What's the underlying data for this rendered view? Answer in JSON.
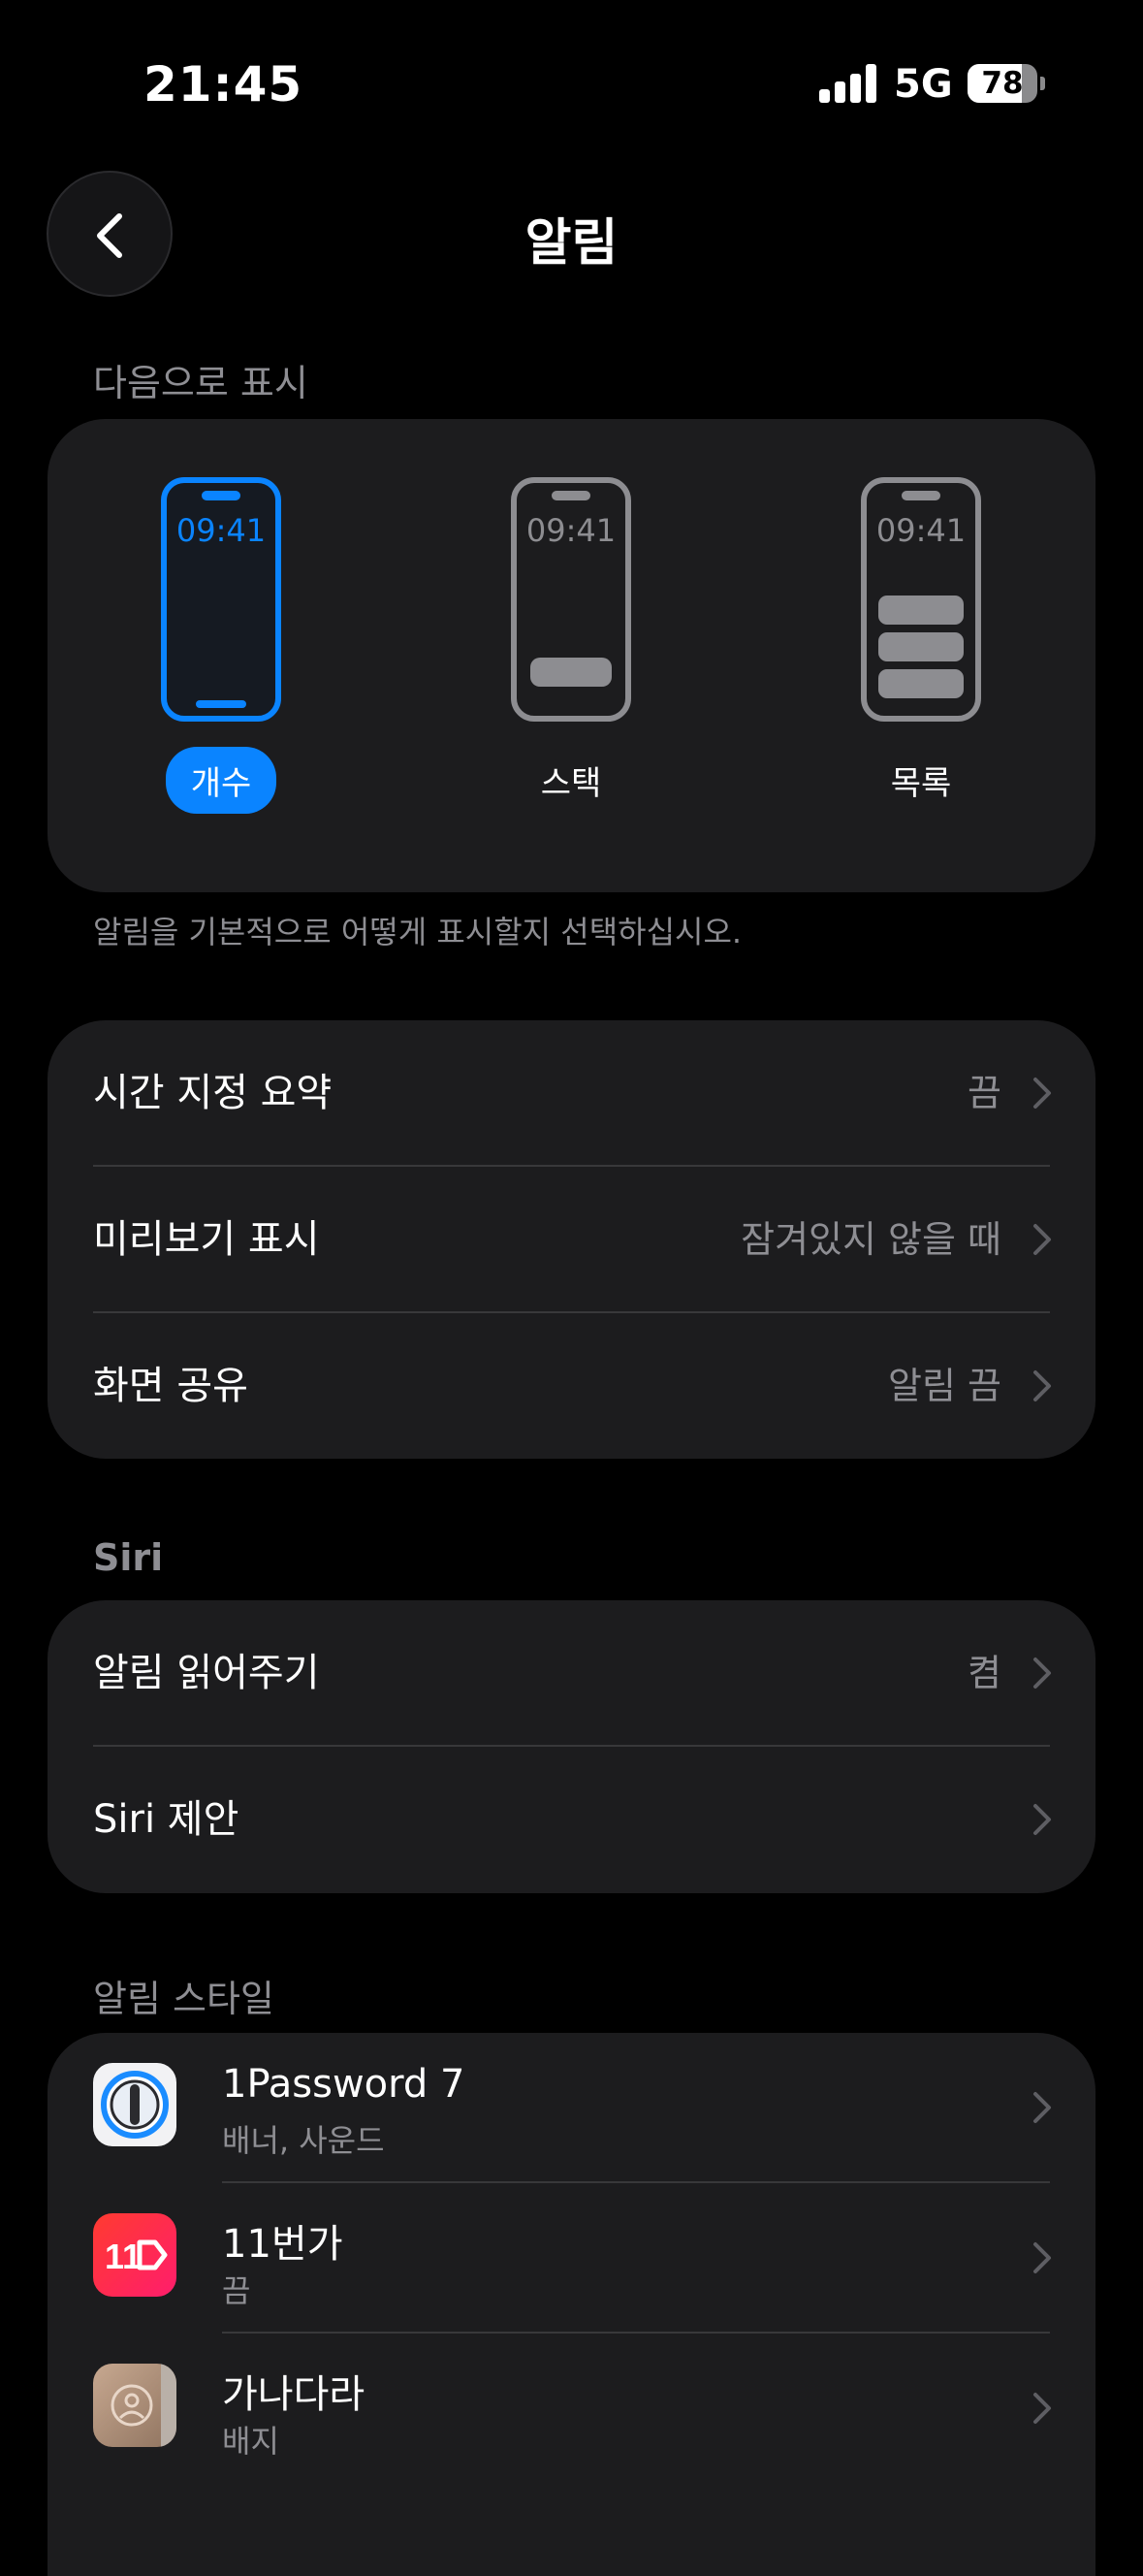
{
  "status_bar": {
    "time": "21:45",
    "network": "5G",
    "battery": "78",
    "battery_level": 0.78
  },
  "nav": {
    "title": "알림"
  },
  "display_section": {
    "header": "다음으로 표시",
    "footnote": "알림을 기본적으로 어떻게 표시할지 선택하십시오.",
    "options": [
      {
        "label": "개수",
        "clock": "09:41",
        "selected": true
      },
      {
        "label": "스택",
        "clock": "09:41",
        "selected": false
      },
      {
        "label": "목록",
        "clock": "09:41",
        "selected": false
      }
    ]
  },
  "settings_rows": [
    {
      "label": "시간 지정 요약",
      "value": "끔"
    },
    {
      "label": "미리보기 표시",
      "value": "잠겨있지 않을 때"
    },
    {
      "label": "화면 공유",
      "value": "알림 끔"
    }
  ],
  "siri_section": {
    "header": "Siri",
    "rows": [
      {
        "label": "알림 읽어주기",
        "value": "켬"
      },
      {
        "label": "Siri 제안",
        "value": ""
      }
    ]
  },
  "style_section": {
    "header": "알림 스타일",
    "apps": [
      {
        "name": "1Password 7",
        "detail": "배너, 사운드",
        "icon": "1password-icon"
      },
      {
        "name": "11번가",
        "detail": "끔",
        "icon_text": "11",
        "icon": "11st-icon",
        "color": "#ff1d55"
      },
      {
        "name": "가나다라",
        "detail": "배지",
        "icon": "contacts-icon"
      }
    ]
  },
  "colors": {
    "accent": "#0a84ff",
    "card": "#1c1c1e",
    "secondary_text": "#8e8e93"
  }
}
